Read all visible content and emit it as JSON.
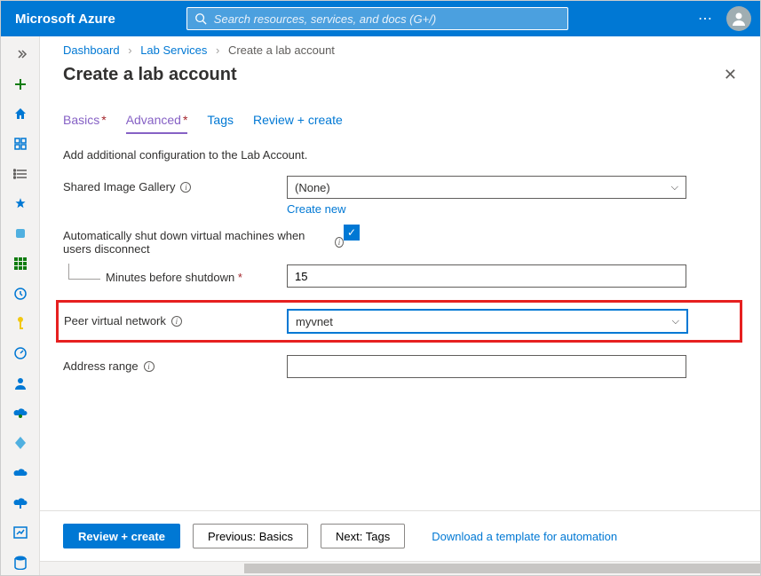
{
  "brand": "Microsoft Azure",
  "search": {
    "placeholder": "Search resources, services, and docs (G+/)"
  },
  "breadcrumb": {
    "items": [
      "Dashboard",
      "Lab Services",
      "Create a lab account"
    ]
  },
  "page": {
    "title": "Create a lab account"
  },
  "tabs": {
    "basics": "Basics",
    "advanced": "Advanced",
    "tags": "Tags",
    "review": "Review + create"
  },
  "form": {
    "description": "Add additional configuration to the Lab Account.",
    "shared_gallery_label": "Shared Image Gallery",
    "shared_gallery_value": "(None)",
    "create_new": "Create new",
    "auto_shutdown_label": "Automatically shut down virtual machines when users disconnect",
    "minutes_label": "Minutes before shutdown",
    "minutes_value": "15",
    "peer_vnet_label": "Peer virtual network",
    "peer_vnet_value": "myvnet",
    "address_range_label": "Address range",
    "address_range_value": ""
  },
  "footer": {
    "review": "Review + create",
    "previous": "Previous: Basics",
    "next": "Next: Tags",
    "download": "Download a template for automation"
  }
}
